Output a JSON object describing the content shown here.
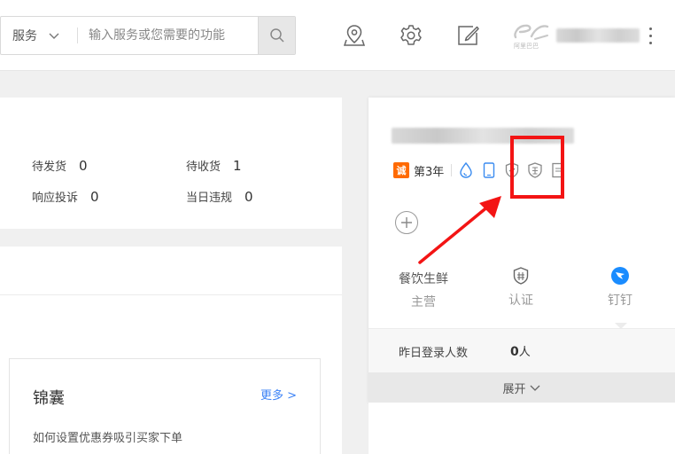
{
  "header": {
    "search": {
      "scope_label": "服务",
      "placeholder": "输入服务或您需要的功能"
    },
    "icons": [
      "location-icon",
      "gear-icon",
      "edit-icon"
    ],
    "logo_sub": "阿里巴巴"
  },
  "stats": {
    "pending_ship_label": "待发货",
    "pending_ship_value": "0",
    "pending_receive_label": "待收货",
    "pending_receive_value": "1",
    "complaint_label": "响应投诉",
    "complaint_value": "0",
    "violation_label": "当日违规",
    "violation_value": "0"
  },
  "news": {
    "title": "锦囊",
    "more_label": "更多 >",
    "item": "如何设置优惠券吸引买家下单"
  },
  "shop": {
    "cheng_badge": "诚",
    "years_label": "第3年",
    "columns": [
      {
        "title": "餐饮生鲜",
        "sub": "主营"
      },
      {
        "title": "",
        "sub": "认证"
      },
      {
        "title": "",
        "sub": "钉钉"
      }
    ],
    "login_label": "昨日登录人数",
    "login_value": "0",
    "login_unit": "人",
    "expand_label": "展开"
  },
  "colors": {
    "accent_orange": "#ff6a00",
    "annotation_red": "#f31414",
    "link_blue": "#3b82f6",
    "dingtalk_blue": "#1a8cff"
  }
}
